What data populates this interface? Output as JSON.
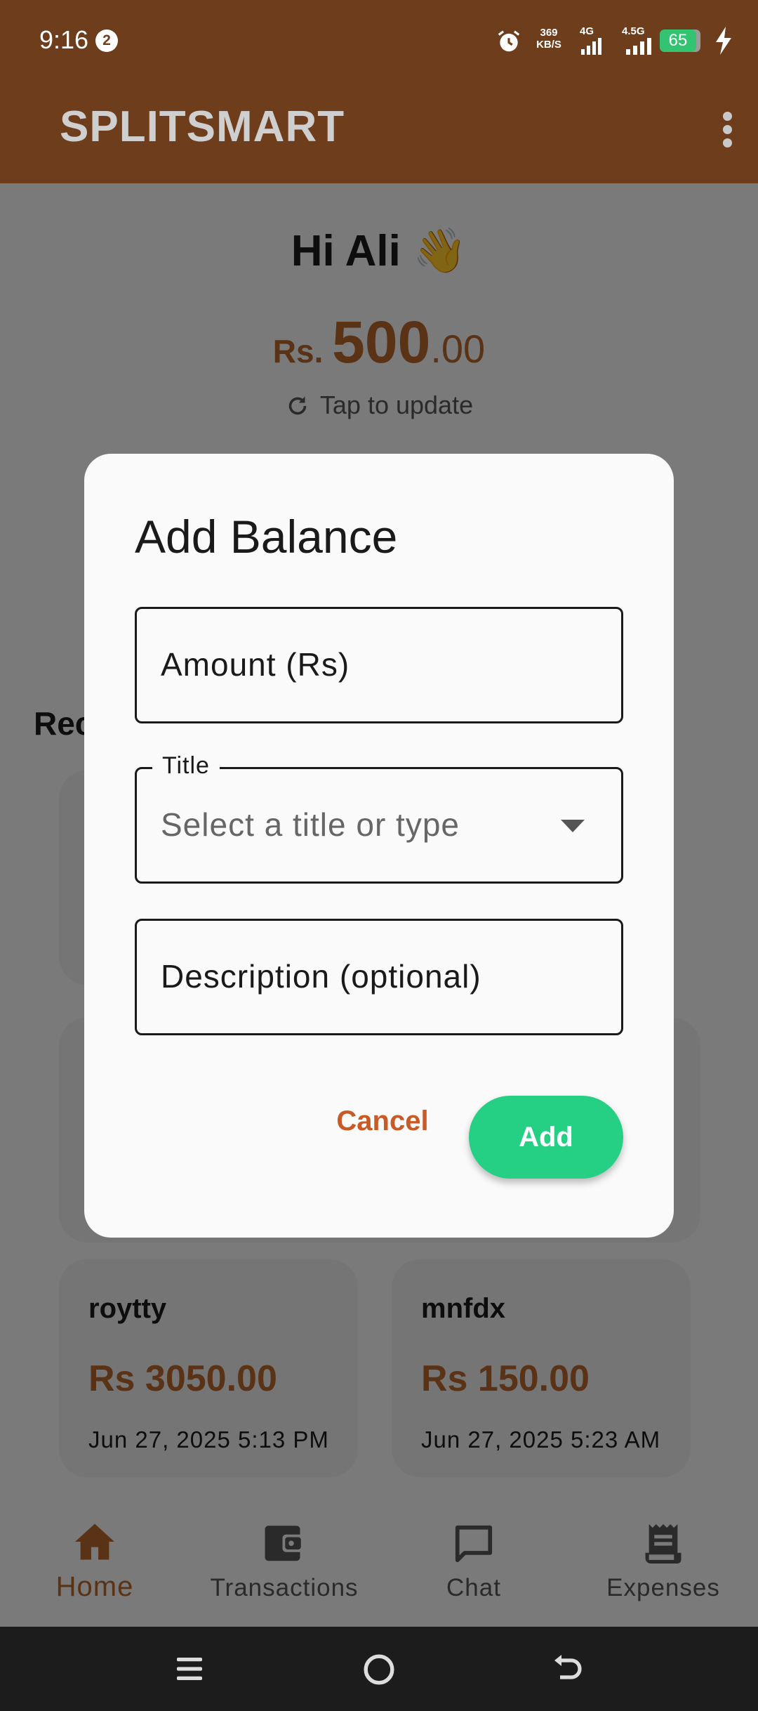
{
  "status_bar": {
    "time": "9:16",
    "notification_count": "2",
    "speed_value": "369",
    "speed_unit": "KB/S",
    "network_1": "4G",
    "network_2": "4.5G",
    "battery": "65"
  },
  "app_bar": {
    "title": "SPLITSMART"
  },
  "home": {
    "greeting": "Hi Ali 👋",
    "balance_prefix": "Rs. ",
    "balance_int": "500",
    "balance_dec": ".00",
    "tap_to_update": "Tap to update",
    "recent_label": "Rec"
  },
  "expense_cards": [
    {
      "name": "roytty",
      "amount": "Rs 3050.00",
      "date": "Jun 27, 2025 5:13 PM"
    },
    {
      "name": "mnfdx",
      "amount": "Rs 150.00",
      "date": "Jun 27, 2025 5:23 AM"
    }
  ],
  "dialog": {
    "title": "Add Balance",
    "amount_label": "Amount (Rs)",
    "title_field_label": "Title",
    "title_field_placeholder": "Select a title or type",
    "description_label": "Description (optional)",
    "cancel_label": "Cancel",
    "add_label": "Add"
  },
  "bottom_nav": [
    {
      "label": "Home",
      "icon": "home-icon",
      "active": true
    },
    {
      "label": "Transactions",
      "icon": "wallet-icon",
      "active": false
    },
    {
      "label": "Chat",
      "icon": "chat-icon",
      "active": false
    },
    {
      "label": "Expenses",
      "icon": "receipt-icon",
      "active": false
    }
  ],
  "colors": {
    "brand_brown": "#6e3d1c",
    "accent_orange": "#b5642c",
    "add_green": "#25cf83",
    "cancel_orange": "#c75a25"
  }
}
